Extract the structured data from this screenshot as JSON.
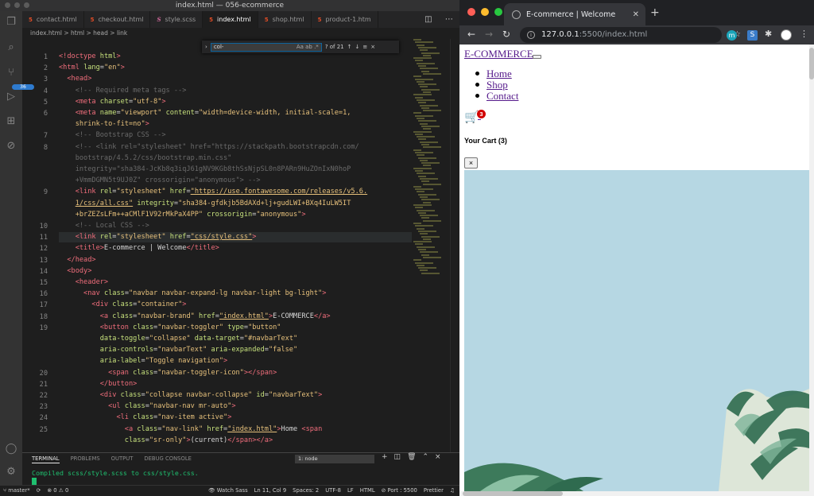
{
  "vscode": {
    "window_title": "index.html — 056-ecommerce",
    "tabs": [
      {
        "label": "contact.html",
        "type": "html",
        "active": false
      },
      {
        "label": "checkout.html",
        "type": "html",
        "active": false
      },
      {
        "label": "style.scss",
        "type": "scss",
        "active": false
      },
      {
        "label": "index.html",
        "type": "html",
        "active": true
      },
      {
        "label": "shop.html",
        "type": "html",
        "active": false
      },
      {
        "label": "product-1.htm",
        "type": "html",
        "active": false
      }
    ],
    "breadcrumb": "index.html  >  html  >  head  >  link",
    "find": {
      "value": "col-",
      "options": "Aa  ab  .*",
      "count": "? of 21"
    },
    "activity_badge": "36",
    "code_lines": [
      {
        "n": "1",
        "html": "<span class=\"t\">&lt;!doctype</span> <span class=\"a\">html</span><span class=\"t\">&gt;</span>"
      },
      {
        "n": "2",
        "html": "<span class=\"t\">&lt;html</span> <span class=\"a\">lang</span>=<span class=\"s\">\"en\"</span><span class=\"t\">&gt;</span>"
      },
      {
        "n": "3",
        "html": "  <span class=\"t\">&lt;head&gt;</span>"
      },
      {
        "n": "4",
        "html": "    <span class=\"c\">&lt;!-- Required meta tags --&gt;</span>"
      },
      {
        "n": "5",
        "html": "    <span class=\"t\">&lt;meta</span> <span class=\"a\">charset</span>=<span class=\"s\">\"utf-8\"</span><span class=\"t\">&gt;</span>"
      },
      {
        "n": "6",
        "html": "    <span class=\"t\">&lt;meta</span> <span class=\"a\">name</span>=<span class=\"s\">\"viewport\"</span> <span class=\"a\">content</span>=<span class=\"s\">\"width=device-width, initial-scale=1,</span>"
      },
      {
        "n": "",
        "html": "    <span class=\"s\">shrink-to-fit=no\"</span><span class=\"t\">&gt;</span>"
      },
      {
        "n": "7",
        "html": "    <span class=\"c\">&lt;!-- Bootstrap CSS --&gt;</span>"
      },
      {
        "n": "8",
        "html": "    <span class=\"c\">&lt;!-- &lt;link rel=\"stylesheet\" href=\"https://stackpath.bootstrapcdn.com/</span>"
      },
      {
        "n": "",
        "html": "    <span class=\"c\">bootstrap/4.5.2/css/bootstrap.min.css\"</span>"
      },
      {
        "n": "",
        "html": "    <span class=\"c\">integrity=\"sha384-JcKb8q3iqJ61gNV9KGb8thSsNjpSL0n8PARn9HuZOnIxN0hoP</span>"
      },
      {
        "n": "",
        "html": "    <span class=\"c\">+VmmDGMN5t9UJ0Z\" crossorigin=\"anonymous\"&gt; --&gt;</span>"
      },
      {
        "n": "9",
        "html": "    <span class=\"t\">&lt;link</span> <span class=\"a\">rel</span>=<span class=\"s\">\"stylesheet\"</span> <span class=\"a\">href</span>=<span class=\"u\">\"https://use.fontawesome.com/releases/v5.6.</span>"
      },
      {
        "n": "",
        "html": "    <span class=\"u\">1/css/all.css\"</span> <span class=\"a\">integrity</span>=<span class=\"s\">\"sha384-gfdkjb5BdAXd+lj+gudLWI+BXq4IuLW5IT</span>"
      },
      {
        "n": "",
        "html": "    <span class=\"s\">+brZEZsLFm++aCMlF1V92rMkPaX4PP\"</span> <span class=\"a\">crossorigin</span>=<span class=\"s\">\"anonymous\"</span><span class=\"t\">&gt;</span>"
      },
      {
        "n": "10",
        "html": "    <span class=\"c\">&lt;!-- Local CSS --&gt;</span>"
      },
      {
        "n": "11",
        "html": "    <span class=\"t\">&lt;link</span> <span class=\"a\">rel</span>=<span class=\"s\">\"stylesheet\"</span> <span class=\"a\">href</span>=<span class=\"u\">\"css/style.css\"</span><span class=\"t\">&gt;</span>",
        "current": true
      },
      {
        "n": "12",
        "html": "    <span class=\"t\">&lt;title&gt;</span>E-commerce | Welcome<span class=\"t\">&lt;/title&gt;</span>"
      },
      {
        "n": "13",
        "html": "  <span class=\"t\">&lt;/head&gt;</span>"
      },
      {
        "n": "14",
        "html": "  <span class=\"t\">&lt;body&gt;</span>"
      },
      {
        "n": "15",
        "html": "    <span class=\"t\">&lt;header&gt;</span>"
      },
      {
        "n": "16",
        "html": "      <span class=\"t\">&lt;nav</span> <span class=\"a\">class</span>=<span class=\"s\">\"navbar navbar-expand-lg navbar-light bg-light\"</span><span class=\"t\">&gt;</span>"
      },
      {
        "n": "17",
        "html": "        <span class=\"t\">&lt;div</span> <span class=\"a\">class</span>=<span class=\"s\">\"container\"</span><span class=\"t\">&gt;</span>"
      },
      {
        "n": "18",
        "html": "          <span class=\"t\">&lt;a</span> <span class=\"a\">class</span>=<span class=\"s\">\"navbar-brand\"</span> <span class=\"a\">href</span>=<span class=\"u\">\"index.html\"</span><span class=\"t\">&gt;</span>E-COMMERCE<span class=\"t\">&lt;/a&gt;</span>"
      },
      {
        "n": "19",
        "html": "          <span class=\"t\">&lt;button</span> <span class=\"a\">class</span>=<span class=\"s\">\"navbar-toggler\"</span> <span class=\"a\">type</span>=<span class=\"s\">\"button\"</span>"
      },
      {
        "n": "",
        "html": "          <span class=\"a\">data-toggle</span>=<span class=\"s\">\"collapse\"</span> <span class=\"a\">data-target</span>=<span class=\"s\">\"#navbarText\"</span>"
      },
      {
        "n": "",
        "html": "          <span class=\"a\">aria-controls</span>=<span class=\"s\">\"navbarText\"</span> <span class=\"a\">aria-expanded</span>=<span class=\"s\">\"false\"</span>"
      },
      {
        "n": "",
        "html": "          <span class=\"a\">aria-label</span>=<span class=\"s\">\"Toggle navigation\"</span><span class=\"t\">&gt;</span>"
      },
      {
        "n": "20",
        "html": "            <span class=\"t\">&lt;span</span> <span class=\"a\">class</span>=<span class=\"s\">\"navbar-toggler-icon\"</span><span class=\"t\">&gt;&lt;/span&gt;</span>"
      },
      {
        "n": "21",
        "html": "          <span class=\"t\">&lt;/button&gt;</span>"
      },
      {
        "n": "22",
        "html": "          <span class=\"t\">&lt;div</span> <span class=\"a\">class</span>=<span class=\"s\">\"collapse navbar-collapse\"</span> <span class=\"a\">id</span>=<span class=\"s\">\"navbarText\"</span><span class=\"t\">&gt;</span>"
      },
      {
        "n": "23",
        "html": "            <span class=\"t\">&lt;ul</span> <span class=\"a\">class</span>=<span class=\"s\">\"navbar-nav mr-auto\"</span><span class=\"t\">&gt;</span>"
      },
      {
        "n": "24",
        "html": "              <span class=\"t\">&lt;li</span> <span class=\"a\">class</span>=<span class=\"s\">\"nav-item active\"</span><span class=\"t\">&gt;</span>"
      },
      {
        "n": "25",
        "html": "                <span class=\"t\">&lt;a</span> <span class=\"a\">class</span>=<span class=\"s\">\"nav-link\"</span> <span class=\"a\">href</span>=<span class=\"u\">\"index.html\"</span><span class=\"t\">&gt;</span>Home <span class=\"t\">&lt;span</span>"
      },
      {
        "n": "",
        "html": "                <span class=\"a\">class</span>=<span class=\"s\">\"sr-only\"</span><span class=\"t\">&gt;</span>(current)<span class=\"t\">&lt;/span&gt;&lt;/a&gt;</span>"
      }
    ],
    "panel": {
      "tabs": [
        "TERMINAL",
        "PROBLEMS",
        "OUTPUT",
        "DEBUG CONSOLE"
      ],
      "active_tab": "TERMINAL",
      "terminal_select": "1: node",
      "terminal_output": "Compiled scss/style.scss to css/style.css."
    },
    "status": {
      "branch": "master*",
      "errors": "0",
      "warnings": "0",
      "watch": "Watch Sass",
      "position": "Ln 11, Col 9",
      "spaces": "Spaces: 2",
      "encoding": "UTF-8",
      "eol": "LF",
      "language": "HTML",
      "port": "Port : 5500",
      "formatter": "Prettier"
    }
  },
  "browser": {
    "tab_title": "E-commerce | Welcome",
    "url_host": "127.0.0.1",
    "url_rest": ":5500/index.html",
    "page": {
      "brand": "E-COMMERCE",
      "nav_links": [
        "Home",
        "Shop",
        "Contact"
      ],
      "cart_count": "3",
      "cart_heading": "Your Cart (3)",
      "close_label": "×"
    }
  },
  "colors": {
    "editor_bg": "#1e1e1e",
    "terminal_green": "#1fbf6f",
    "link_visited": "#551a8b",
    "cart_purple": "#5b21a6",
    "badge_red": "#d10000",
    "hero_sky": "#b6d7e3"
  }
}
